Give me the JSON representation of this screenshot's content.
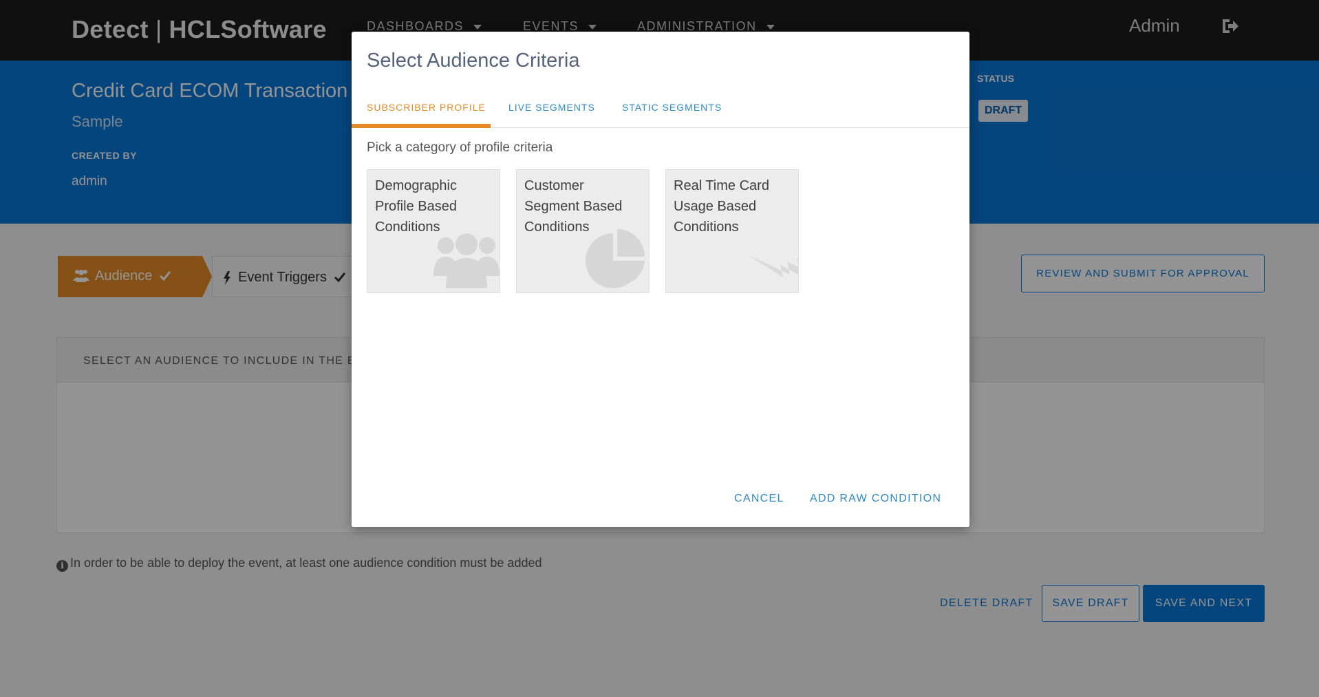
{
  "nav": {
    "brand_left": "Detect",
    "brand_sep": "|",
    "brand_right": "HCLSoftware",
    "menus": [
      {
        "label": "DASHBOARDS"
      },
      {
        "label": "EVENTS"
      },
      {
        "label": "ADMINISTRATION"
      }
    ],
    "user": "Admin"
  },
  "header": {
    "title": "Credit Card ECOM Transaction",
    "subtitle": "Sample",
    "created_by_label": "CREATED BY",
    "created_by_value": "admin",
    "status_label": "STATUS",
    "status_value": "DRAFT"
  },
  "stepper": {
    "step1": "Audience",
    "step2": "Event Triggers"
  },
  "main": {
    "review_button": "REVIEW AND SUBMIT FOR APPROVAL",
    "panel_heading": "SELECT AN AUDIENCE TO INCLUDE IN THE EVE",
    "info_note": "In order to be able to deploy the event, at least one audience condition must be added",
    "delete_draft": "DELETE DRAFT",
    "save_draft": "SAVE DRAFT",
    "save_next": "SAVE AND NEXT"
  },
  "modal": {
    "title": "Select Audience Criteria",
    "tabs": [
      {
        "label": "SUBSCRIBER PROFILE",
        "active": true
      },
      {
        "label": "LIVE SEGMENTS",
        "active": false
      },
      {
        "label": "STATIC SEGMENTS",
        "active": false
      }
    ],
    "hint": "Pick a category of profile criteria",
    "cards": [
      {
        "label": "Demographic Profile Based Conditions",
        "icon": "users-icon"
      },
      {
        "label": "Customer Segment Based Conditions",
        "icon": "pie-chart-icon"
      },
      {
        "label": "Real Time Card Usage Based Conditions",
        "icon": "lightning-icon"
      }
    ],
    "cancel": "CANCEL",
    "add_raw": "ADD RAW CONDITION"
  },
  "colors": {
    "accent_orange": "#e58a25",
    "primary_blue": "#0a78d8",
    "nav_dark": "#1c1c1c"
  }
}
